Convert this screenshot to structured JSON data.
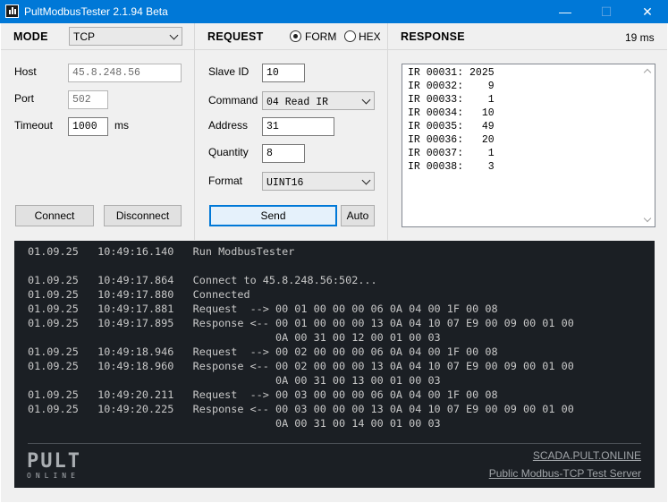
{
  "window": {
    "title": "PultModbusTester 2.1.94 Beta",
    "minimize_glyph": "—",
    "maximize_glyph": "☐",
    "close_glyph": "✕"
  },
  "mode": {
    "header": "MODE",
    "selected": "TCP",
    "host_label": "Host",
    "host_value": "45.8.248.56",
    "port_label": "Port",
    "port_value": "502",
    "timeout_label": "Timeout",
    "timeout_value": "1000",
    "timeout_unit": "ms",
    "connect_label": "Connect",
    "disconnect_label": "Disconnect"
  },
  "request": {
    "header": "REQUEST",
    "form_label": "FORM",
    "hex_label": "HEX",
    "form_selected": true,
    "slave_id_label": "Slave ID",
    "slave_id_value": "10",
    "command_label": "Command",
    "command_value": "04 Read IR",
    "address_label": "Address",
    "address_value": "31",
    "quantity_label": "Quantity",
    "quantity_value": "8",
    "format_label": "Format",
    "format_value": "UINT16",
    "send_label": "Send",
    "auto_label": "Auto"
  },
  "response": {
    "header": "RESPONSE",
    "time": "19 ms",
    "lines": [
      "IR 00031: 2025",
      "IR 00032:    9",
      "IR 00033:    1",
      "IR 00034:   10",
      "IR 00035:   49",
      "IR 00036:   20",
      "IR 00037:    1",
      "IR 00038:    3"
    ]
  },
  "log": {
    "lines": [
      "01.09.25   10:49:16.140   Run ModbusTester",
      "",
      "01.09.25   10:49:17.864   Connect to 45.8.248.56:502...",
      "01.09.25   10:49:17.880   Connected",
      "01.09.25   10:49:17.881   Request  --> 00 01 00 00 00 06 0A 04 00 1F 00 08",
      "01.09.25   10:49:17.895   Response <-- 00 01 00 00 00 13 0A 04 10 07 E9 00 09 00 01 00",
      "                                       0A 00 31 00 12 00 01 00 03",
      "01.09.25   10:49:18.946   Request  --> 00 02 00 00 00 06 0A 04 00 1F 00 08",
      "01.09.25   10:49:18.960   Response <-- 00 02 00 00 00 13 0A 04 10 07 E9 00 09 00 01 00",
      "                                       0A 00 31 00 13 00 01 00 03",
      "01.09.25   10:49:20.211   Request  --> 00 03 00 00 00 06 0A 04 00 1F 00 08",
      "01.09.25   10:49:20.225   Response <-- 00 03 00 00 00 13 0A 04 10 07 E9 00 09 00 01 00",
      "                                       0A 00 31 00 14 00 01 00 03"
    ]
  },
  "footer": {
    "logo_main": "PULT",
    "logo_sub": "ONLINE",
    "link_site": "SCADA.PULT.ONLINE",
    "link_server": "Public Modbus-TCP Test Server"
  }
}
